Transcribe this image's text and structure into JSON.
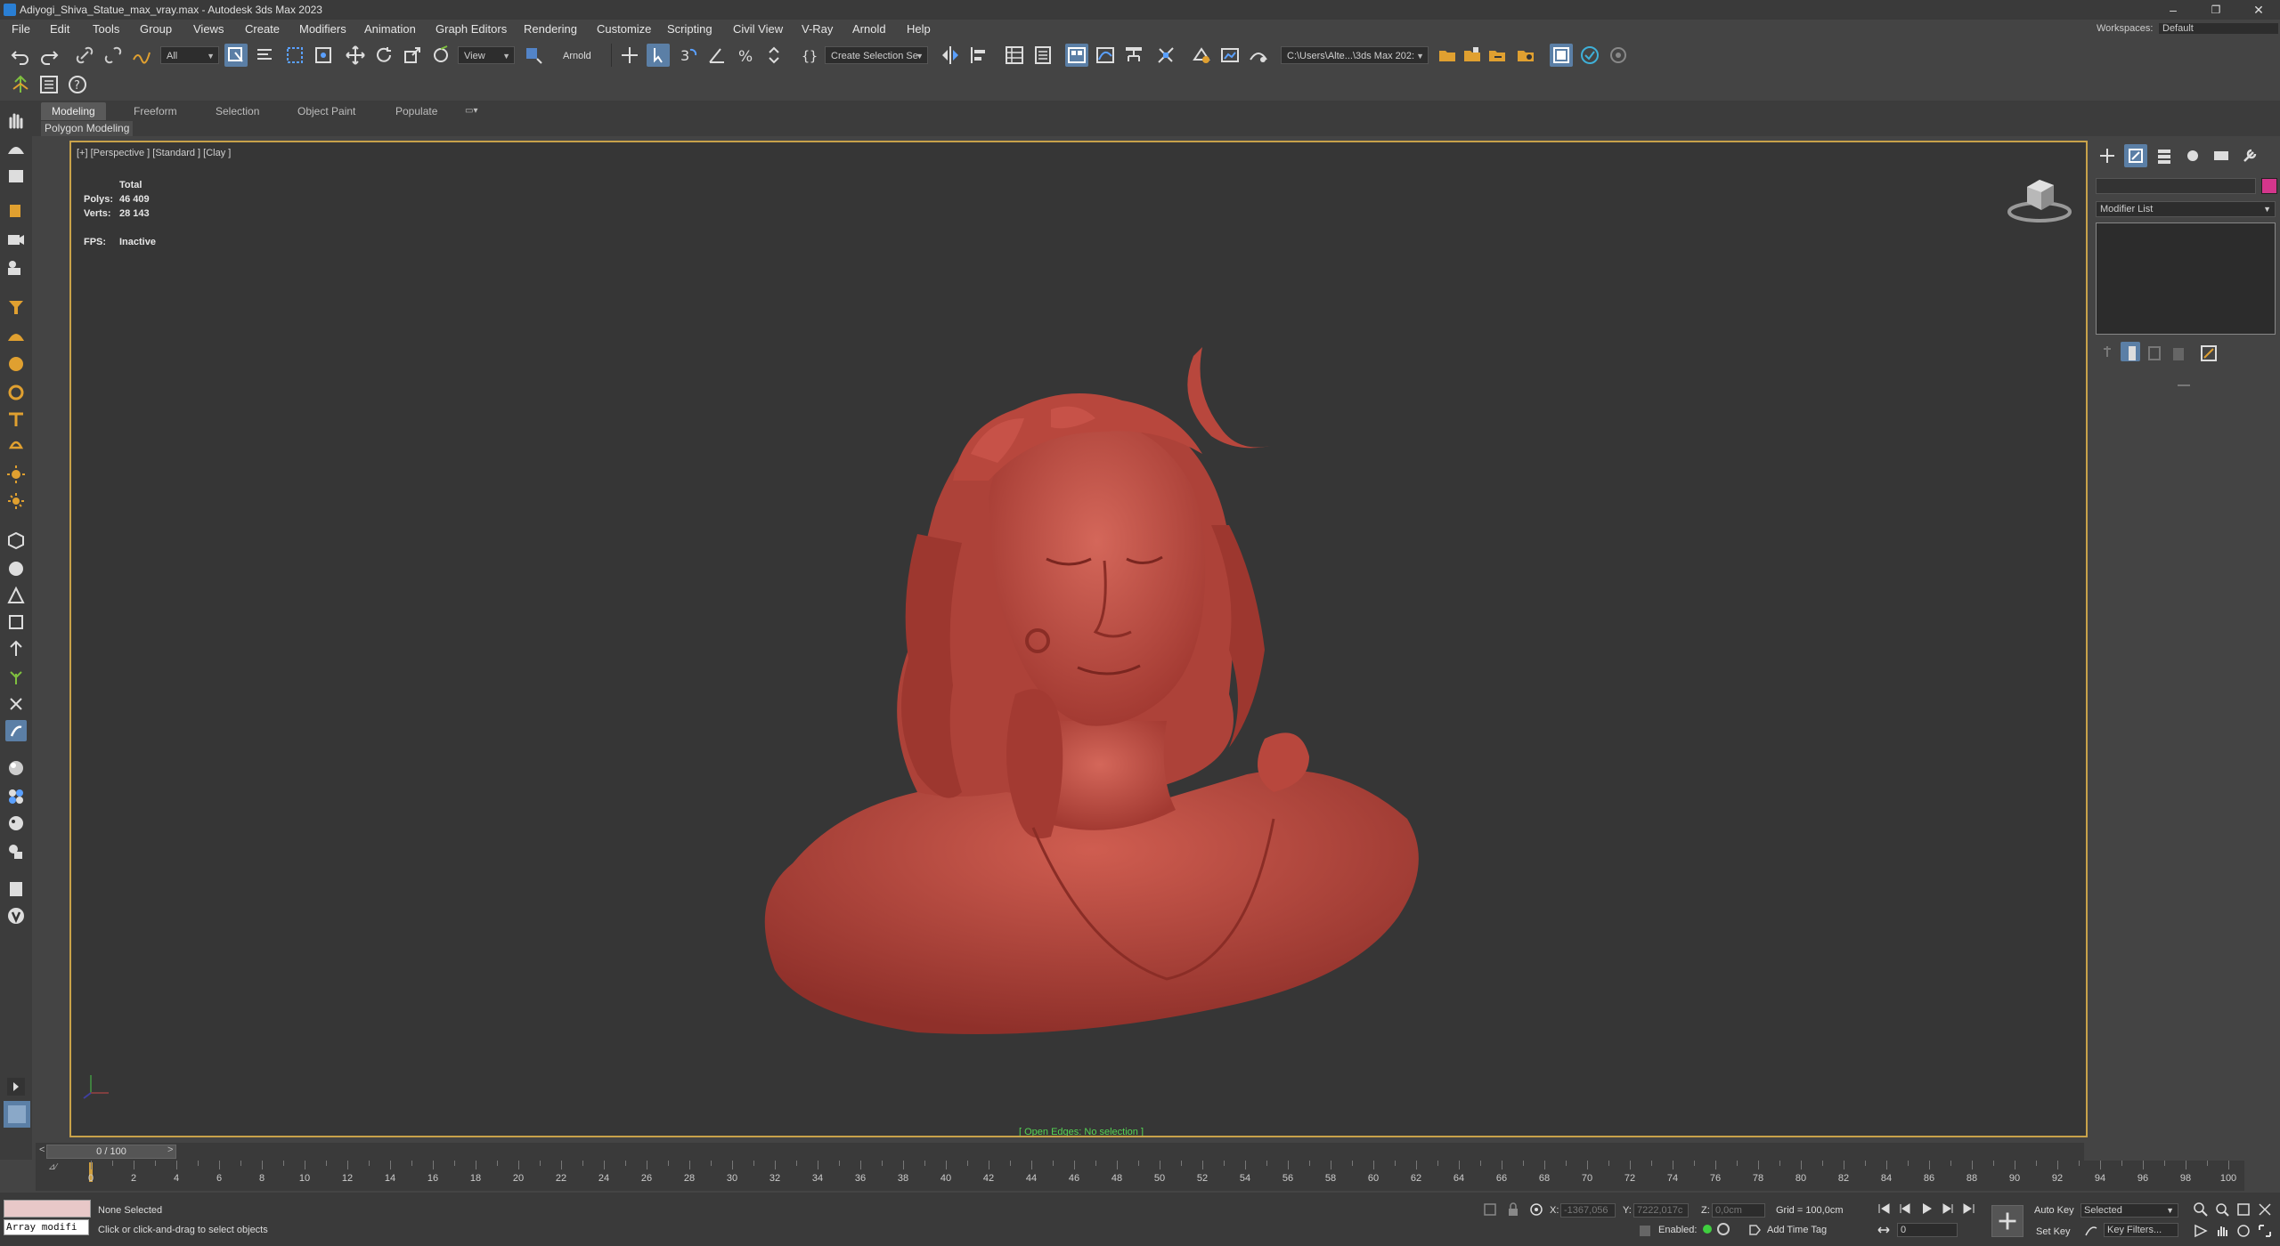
{
  "window": {
    "title": "Adiyogi_Shiva_Statue_max_vray.max - Autodesk 3ds Max 2023",
    "minimize": "–",
    "maximize": "❐",
    "close": "✕"
  },
  "menubar": {
    "items": [
      "File",
      "Edit",
      "Tools",
      "Group",
      "Views",
      "Create",
      "Modifiers",
      "Animation",
      "Graph Editors",
      "Rendering",
      "Customize",
      "Scripting",
      "Civil View",
      "V-Ray",
      "Arnold",
      "Help"
    ],
    "workspaces_label": "Workspaces:",
    "workspaces_value": "Default"
  },
  "toolbar": {
    "selection_filter": "All",
    "ref_coord": "View",
    "arnold_label": "Arnold",
    "named_selection": "Create Selection Se",
    "project_path": "C:\\Users\\Alte...\\3ds Max 202:"
  },
  "ribbon": {
    "tabs": [
      "Modeling",
      "Freeform",
      "Selection",
      "Object Paint",
      "Populate"
    ],
    "active_tab": "Modeling",
    "sub_panel": "Polygon Modeling"
  },
  "viewport": {
    "label": "[+] [Perspective ] [Standard ] [Clay ]",
    "stats_header": "Total",
    "polys_label": "Polys:",
    "polys_value": "46 409",
    "verts_label": "Verts:",
    "verts_value": "28 143",
    "fps_label": "FPS:",
    "fps_value": "Inactive",
    "status_text": "[ Open Edges: No selection ]",
    "model_color": "#c14a3f"
  },
  "command_panel": {
    "modifier_list": "Modifier List",
    "color_swatch": "#d4368c"
  },
  "timeline": {
    "frame_display": "0 / 100",
    "prev": "<",
    "next": ">",
    "tick_labels": [
      "0",
      "2",
      "4",
      "6",
      "8",
      "10",
      "12",
      "14",
      "16",
      "18",
      "20",
      "22",
      "24",
      "26",
      "28",
      "30",
      "32",
      "34",
      "36",
      "38",
      "40",
      "42",
      "44",
      "46",
      "48",
      "50",
      "52",
      "54",
      "56",
      "58",
      "60",
      "62",
      "64",
      "66",
      "68",
      "70",
      "72",
      "74",
      "76",
      "78",
      "80",
      "82",
      "84",
      "86",
      "88",
      "90",
      "92",
      "94",
      "96",
      "98",
      "100"
    ]
  },
  "status": {
    "selection": "None Selected",
    "prompt": "Click or click-and-drag to select objects",
    "maxscript": "Array modifi",
    "x_label": "X:",
    "x_value": "-1367,056",
    "y_label": "Y:",
    "y_value": "7222,017c",
    "z_label": "Z:",
    "z_value": "0,0cm",
    "grid": "Grid = 100,0cm",
    "enabled_label": "Enabled:",
    "add_time_tag": "Add Time Tag",
    "auto_key": "Auto Key",
    "set_key": "Set Key",
    "key_mode": "Selected",
    "key_filters": "Key Filters...",
    "frame_value": "0"
  }
}
